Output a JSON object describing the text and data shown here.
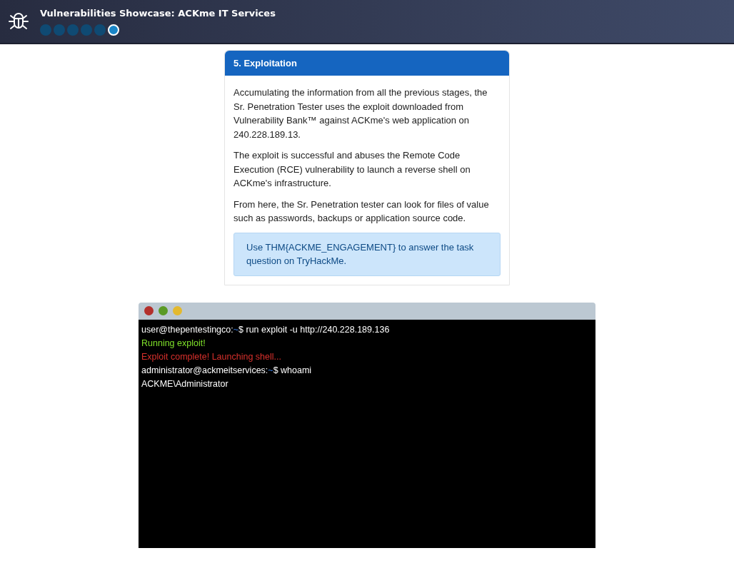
{
  "header": {
    "title": "Vulnerabilities Showcase: ACKme IT Services",
    "steps": [
      {
        "selected": false
      },
      {
        "selected": false
      },
      {
        "selected": false
      },
      {
        "selected": false
      },
      {
        "selected": false
      },
      {
        "selected": true
      }
    ]
  },
  "card": {
    "title": "5. Exploitation",
    "paragraphs": [
      "Accumulating the information from all the previous stages, the Sr. Penetration Tester uses the exploit downloaded from Vulnerability Bank™ against ACKme's web application on 240.228.189.13.",
      "The exploit is successful and abuses the Remote Code Execution (RCE) vulnerability to launch a reverse shell on ACKme's infrastructure.",
      "From here, the Sr. Penetration tester can look for files of value such as passwords, backups or application source code."
    ],
    "notice": "Use THM{ACKME_ENGAGEMENT} to answer the task question on TryHackMe."
  },
  "terminal": {
    "lines": [
      {
        "kind": "prompt",
        "host": "user@thepentestingco:",
        "path": "~",
        "command": "$ run exploit -u http://240.228.189.136"
      },
      {
        "kind": "success",
        "text": "Running exploit!"
      },
      {
        "kind": "error",
        "text": "Exploit complete! Launching shell..."
      },
      {
        "kind": "prompt",
        "host": "administrator@ackmeitservices:",
        "path": "~",
        "command": "$ whoami"
      },
      {
        "kind": "output",
        "text": "ACKME\\Administrator"
      }
    ]
  }
}
